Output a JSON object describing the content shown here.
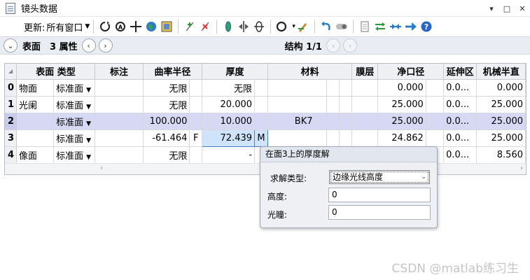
{
  "window": {
    "title": "镜头数据",
    "controls": [
      "▾",
      "□",
      "✕"
    ]
  },
  "toolbar": {
    "update_label": "更新:",
    "update_value": "所有窗口"
  },
  "nav": {
    "surface_label": "表面",
    "surface_value": "3 属性",
    "structure_label": "结构 1/1"
  },
  "table": {
    "columns": [
      "表面 类型",
      "标注",
      "曲率半径",
      "厚度",
      "材料",
      "膜层",
      "净口径",
      "延伸区",
      "机械半直"
    ],
    "rows": [
      {
        "index": "0",
        "name": "物面",
        "type": "标准面",
        "note": "",
        "radius": "无限",
        "radius_flag": "",
        "thickness": "无限",
        "thickness_flag": "",
        "material": "",
        "coating": "",
        "clear": "0.000",
        "chip": "0.0...",
        "mech": "0.000"
      },
      {
        "index": "1",
        "name": "光阑",
        "type": "标准面",
        "note": "",
        "radius": "无限",
        "radius_flag": "",
        "thickness": "20.000",
        "thickness_flag": "",
        "material": "",
        "coating": "",
        "clear": "25.000",
        "chip": "0.0...",
        "mech": "25.000"
      },
      {
        "index": "2",
        "name": "",
        "type": "标准面",
        "note": "",
        "radius": "100.000",
        "radius_flag": "",
        "thickness": "10.000",
        "thickness_flag": "",
        "material": "BK7",
        "coating": "",
        "clear": "25.000",
        "chip": "0.0...",
        "mech": "25.000"
      },
      {
        "index": "3",
        "name": "",
        "type": "标准面",
        "note": "",
        "radius": "-61.464",
        "radius_flag": "F",
        "thickness": "72.439",
        "thickness_flag": "M",
        "material": "",
        "coating": "",
        "clear": "24.862",
        "chip": "0.0...",
        "mech": "25.000"
      },
      {
        "index": "4",
        "name": "像面",
        "type": "标准面",
        "note": "",
        "radius": "无限",
        "radius_flag": "",
        "thickness": "-",
        "thickness_flag": "",
        "material": "",
        "coating": "",
        "clear": "",
        "chip": "0.0...",
        "mech": "8.560"
      }
    ]
  },
  "solve_popup": {
    "title": "在面3上的厚度解",
    "solve_type_label": "求解类型:",
    "solve_type_value": "边缘光线高度",
    "height_label": "高度:",
    "height_value": "0",
    "pupil_label": "光瞳:",
    "pupil_value": "0"
  },
  "watermark": "CSDN @matlab练习生",
  "colors": {
    "selected_row": "#d7d8f4",
    "editing_cell": "#cfe3fb",
    "header_bg": "#eef0f3",
    "nav_bg": "#e9edf3"
  }
}
